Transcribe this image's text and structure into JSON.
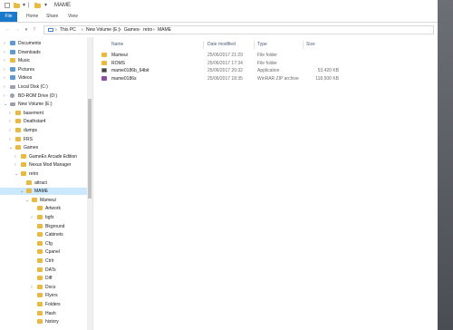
{
  "window": {
    "title": "MAME",
    "quick_access_sep": "|",
    "quick_access_arrow": "▾",
    "controls": [
      "—",
      "☐",
      "✕"
    ]
  },
  "ribbon": {
    "tabs": [
      "File",
      "Home",
      "Share",
      "View"
    ]
  },
  "address": {
    "back": "←",
    "forward": "→",
    "recent": "▾",
    "up": "↑",
    "crumbs": [
      "This PC",
      "New Volume (E:)",
      "Games",
      "retro",
      "MAME"
    ],
    "separator": "›"
  },
  "nav_tree": [
    {
      "label": "Documents",
      "icon": "folder-blue",
      "level": 1,
      "chevron": "›"
    },
    {
      "label": "Downloads",
      "icon": "folder-blue",
      "level": 1,
      "chevron": "›"
    },
    {
      "label": "Music",
      "icon": "music",
      "level": 1,
      "chevron": "›"
    },
    {
      "label": "Pictures",
      "icon": "folder-blue",
      "level": 1,
      "chevron": "›"
    },
    {
      "label": "Videos",
      "icon": "folder-blue",
      "level": 1,
      "chevron": "›"
    },
    {
      "label": "Local Disk (C:)",
      "icon": "drive",
      "level": 1,
      "chevron": "›"
    },
    {
      "label": "BD-ROM Drive (D:)",
      "icon": "disc",
      "level": 1,
      "chevron": "›"
    },
    {
      "label": "New Volume (E:)",
      "icon": "drive",
      "level": 1,
      "chevron": "⌄"
    },
    {
      "label": "basement",
      "icon": "folder",
      "level": 2,
      "chevron": "›"
    },
    {
      "label": "Deathstar4",
      "icon": "folder",
      "level": 2,
      "chevron": "›"
    },
    {
      "label": "dumps",
      "icon": "folder",
      "level": 2,
      "chevron": "›"
    },
    {
      "label": "FRS",
      "icon": "folder",
      "level": 2,
      "chevron": "›"
    },
    {
      "label": "Games",
      "icon": "folder",
      "level": 2,
      "chevron": "⌄"
    },
    {
      "label": "GameEx Arcade Edition",
      "icon": "folder",
      "level": 3,
      "chevron": "›"
    },
    {
      "label": "Nexus Mod Manager",
      "icon": "folder",
      "level": 3,
      "chevron": "›"
    },
    {
      "label": "retro",
      "icon": "folder",
      "level": 3,
      "chevron": "⌄"
    },
    {
      "label": "attract",
      "icon": "folder",
      "level": 4,
      "chevron": ""
    },
    {
      "label": "MAME",
      "icon": "folder",
      "level": 4,
      "chevron": "⌄",
      "selected": true
    },
    {
      "label": "Mameui",
      "icon": "folder",
      "level": 5,
      "chevron": "⌄"
    },
    {
      "label": "Artwork",
      "icon": "folder",
      "level": 6,
      "chevron": ""
    },
    {
      "label": "bgfx",
      "icon": "folder",
      "level": 6,
      "chevron": "›"
    },
    {
      "label": "Bkground",
      "icon": "folder",
      "level": 6,
      "chevron": ""
    },
    {
      "label": "Cabinets",
      "icon": "folder",
      "level": 6,
      "chevron": ""
    },
    {
      "label": "Cfg",
      "icon": "folder",
      "level": 6,
      "chevron": ""
    },
    {
      "label": "Cpanel",
      "icon": "folder",
      "level": 6,
      "chevron": ""
    },
    {
      "label": "Ctrlr",
      "icon": "folder",
      "level": 6,
      "chevron": ""
    },
    {
      "label": "DATs",
      "icon": "folder",
      "level": 6,
      "chevron": ""
    },
    {
      "label": "Diff",
      "icon": "folder",
      "level": 6,
      "chevron": ""
    },
    {
      "label": "Docs",
      "icon": "folder",
      "level": 6,
      "chevron": "›"
    },
    {
      "label": "Flyers",
      "icon": "folder",
      "level": 6,
      "chevron": ""
    },
    {
      "label": "Folders",
      "icon": "folder",
      "level": 6,
      "chevron": ""
    },
    {
      "label": "Hash",
      "icon": "folder",
      "level": 6,
      "chevron": ""
    },
    {
      "label": "history",
      "icon": "folder",
      "level": 6,
      "chevron": ""
    }
  ],
  "columns": [
    "Name",
    "Date modified",
    "Type",
    "Size"
  ],
  "files": [
    {
      "name": "Mameui",
      "date": "25/06/2017 21:29",
      "type": "File folder",
      "size": "",
      "icon": "folder"
    },
    {
      "name": "ROMS",
      "date": "25/06/2017 17:34",
      "type": "File folder",
      "size": "",
      "icon": "folder"
    },
    {
      "name": "mame0186b_64bit",
      "date": "25/06/2017 20:32",
      "type": "Application",
      "size": "53,420 KB",
      "icon": "app"
    },
    {
      "name": "mame0186s",
      "date": "25/06/2017 18:35",
      "type": "WinRAR ZIP archive",
      "size": "118,500 KB",
      "icon": "rar"
    }
  ]
}
